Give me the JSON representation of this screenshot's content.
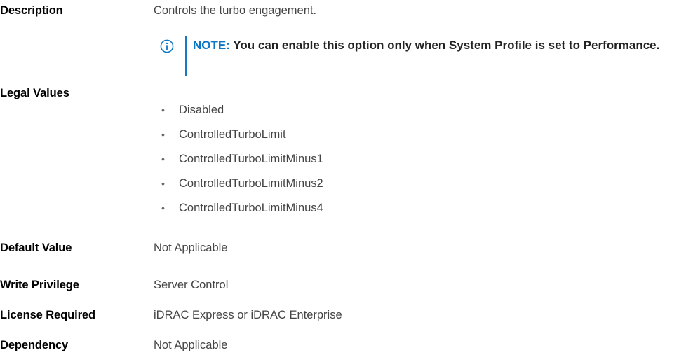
{
  "description": {
    "label": "Description",
    "value": "Controls the turbo engagement."
  },
  "note": {
    "icon": "info-circle-icon",
    "prefix": "NOTE: ",
    "text": "You can enable this option only when System Profile is set to Performance."
  },
  "legal_values": {
    "label": "Legal Values",
    "items": [
      "Disabled",
      "ControlledTurboLimit",
      "ControlledTurboLimitMinus1",
      "ControlledTurboLimitMinus2",
      "ControlledTurboLimitMinus4"
    ]
  },
  "default_value": {
    "label": "Default Value",
    "value": "Not Applicable"
  },
  "write_privilege": {
    "label": "Write Privilege",
    "value": "Server Control"
  },
  "license_required": {
    "label": "License Required",
    "value": "iDRAC Express or iDRAC Enterprise"
  },
  "dependency": {
    "label": "Dependency",
    "value": "Not Applicable"
  },
  "colors": {
    "note_accent": "#0a76c4",
    "label_text": "#000000",
    "body_text": "#444444"
  }
}
